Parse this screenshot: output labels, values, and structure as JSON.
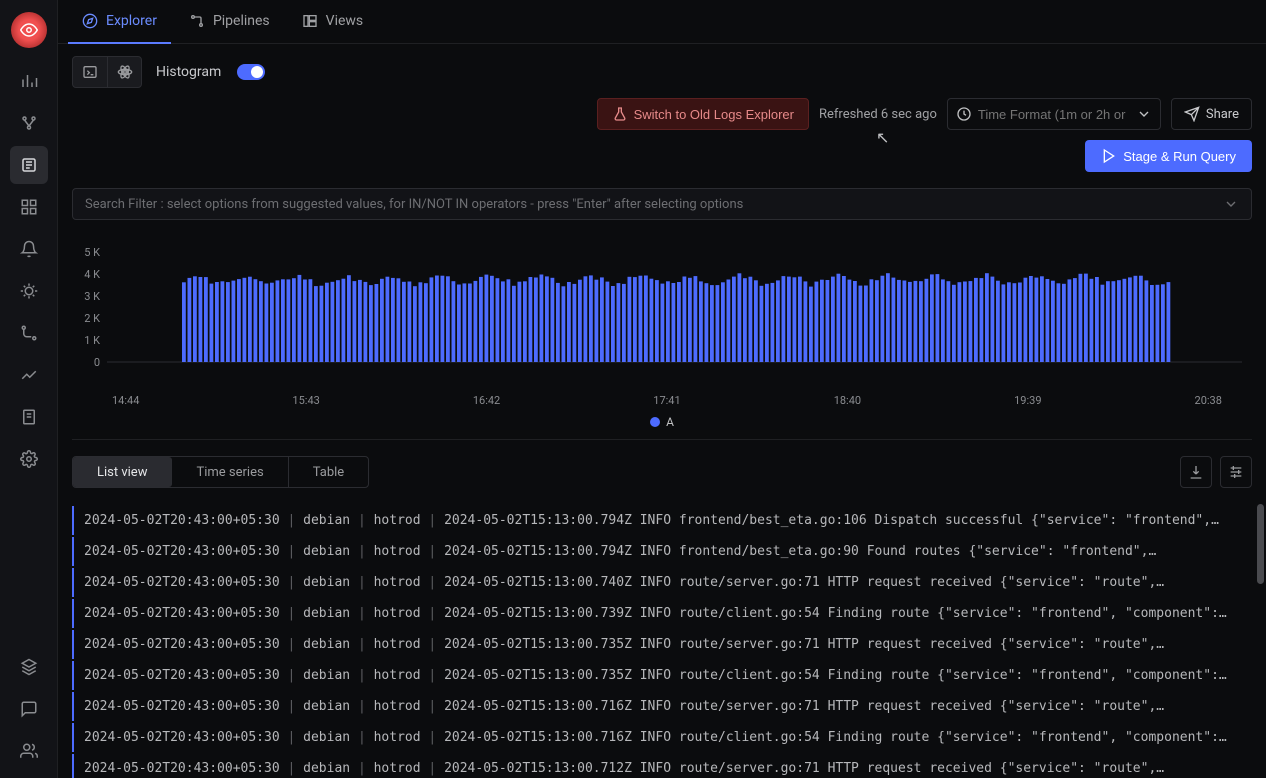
{
  "tabs": [
    {
      "label": "Explorer",
      "active": true
    },
    {
      "label": "Pipelines",
      "active": false
    },
    {
      "label": "Views",
      "active": false
    }
  ],
  "toolbar": {
    "histogram_label": "Histogram",
    "switch_label": "Switch to Old Logs Explorer",
    "refreshed_label": "Refreshed 6 sec ago",
    "time_placeholder": "Time Format (1m or 2h or",
    "share_label": "Share",
    "run_label": "Stage & Run Query"
  },
  "search": {
    "placeholder": "Search Filter : select options from suggested values, for IN/NOT IN operators - press \"Enter\" after selecting options"
  },
  "chart_data": {
    "type": "bar",
    "categories": [
      "14:44",
      "15:43",
      "16:42",
      "17:41",
      "18:40",
      "19:39",
      "20:38"
    ],
    "y_ticks": [
      "5 K",
      "4 K",
      "3 K",
      "2 K",
      "1 K",
      "0"
    ],
    "ylim": [
      0,
      5000
    ],
    "series": [
      {
        "name": "A",
        "approx_value": 4200,
        "color": "#4d6bff"
      }
    ],
    "legend": "A"
  },
  "view_tabs": [
    {
      "label": "List view",
      "active": true
    },
    {
      "label": "Time series",
      "active": false
    },
    {
      "label": "Table",
      "active": false
    }
  ],
  "logs": [
    {
      "ts": "2024-05-02T20:43:00+05:30",
      "host": "debian",
      "svc": "hotrod",
      "msg": "2024-05-02T15:13:00.794Z INFO frontend/best_eta.go:106 Dispatch successful {\"service\": \"frontend\",…"
    },
    {
      "ts": "2024-05-02T20:43:00+05:30",
      "host": "debian",
      "svc": "hotrod",
      "msg": "2024-05-02T15:13:00.794Z INFO frontend/best_eta.go:90 Found routes {\"service\": \"frontend\",…"
    },
    {
      "ts": "2024-05-02T20:43:00+05:30",
      "host": "debian",
      "svc": "hotrod",
      "msg": "2024-05-02T15:13:00.740Z INFO route/server.go:71 HTTP request received {\"service\": \"route\",…"
    },
    {
      "ts": "2024-05-02T20:43:00+05:30",
      "host": "debian",
      "svc": "hotrod",
      "msg": "2024-05-02T15:13:00.739Z INFO route/client.go:54 Finding route {\"service\": \"frontend\", \"component\":…"
    },
    {
      "ts": "2024-05-02T20:43:00+05:30",
      "host": "debian",
      "svc": "hotrod",
      "msg": "2024-05-02T15:13:00.735Z INFO route/server.go:71 HTTP request received {\"service\": \"route\",…"
    },
    {
      "ts": "2024-05-02T20:43:00+05:30",
      "host": "debian",
      "svc": "hotrod",
      "msg": "2024-05-02T15:13:00.735Z INFO route/client.go:54 Finding route {\"service\": \"frontend\", \"component\":…"
    },
    {
      "ts": "2024-05-02T20:43:00+05:30",
      "host": "debian",
      "svc": "hotrod",
      "msg": "2024-05-02T15:13:00.716Z INFO route/server.go:71 HTTP request received {\"service\": \"route\",…"
    },
    {
      "ts": "2024-05-02T20:43:00+05:30",
      "host": "debian",
      "svc": "hotrod",
      "msg": "2024-05-02T15:13:00.716Z INFO route/client.go:54 Finding route {\"service\": \"frontend\", \"component\":…"
    },
    {
      "ts": "2024-05-02T20:43:00+05:30",
      "host": "debian",
      "svc": "hotrod",
      "msg": "2024-05-02T15:13:00.712Z INFO route/server.go:71 HTTP request received {\"service\": \"route\",…"
    }
  ]
}
